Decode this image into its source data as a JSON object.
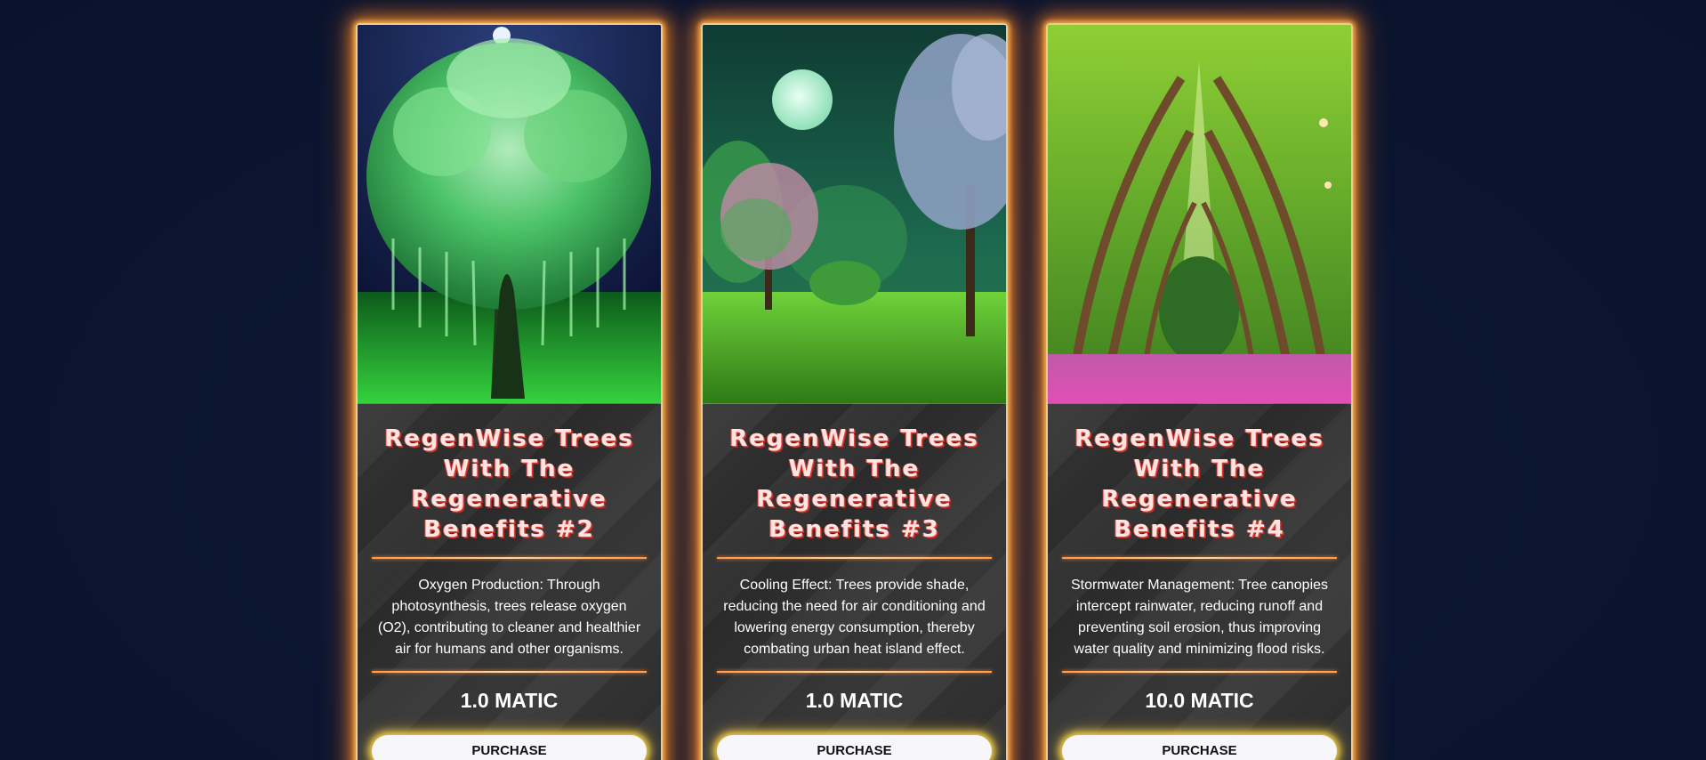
{
  "cards": [
    {
      "image_alt": "Glowing green willow tree at night",
      "title": "RegenWise Trees With The Regenerative Benefits #2",
      "description": "Oxygen Production: Through photosynthesis, trees release oxygen (O2), contributing to cleaner and healthier air for humans and other organisms.",
      "price": "1.0 MATIC",
      "button_label": "PURCHASE"
    },
    {
      "image_alt": "Moonlit green meadow with blossoming trees",
      "title": "RegenWise Trees With The Regenerative Benefits #3",
      "description": "Cooling Effect: Trees provide shade, reducing the need for air conditioning and lowering energy consumption, thereby combating urban heat island effect.",
      "price": "1.0 MATIC",
      "button_label": "PURCHASE"
    },
    {
      "image_alt": "Tree-lined avenue with pink flower path",
      "title": "RegenWise Trees With The Regenerative Benefits #4",
      "description": "Stormwater Management: Tree canopies intercept rainwater, reducing runoff and preventing soil erosion, thus improving water quality and minimizing flood risks.",
      "price": "10.0 MATIC",
      "button_label": "PURCHASE"
    }
  ],
  "colors": {
    "background": "#0c1630",
    "card_glow": "#ff8a3a",
    "button_glow": "#f5d24a",
    "title_shadow": "#e0463a"
  }
}
